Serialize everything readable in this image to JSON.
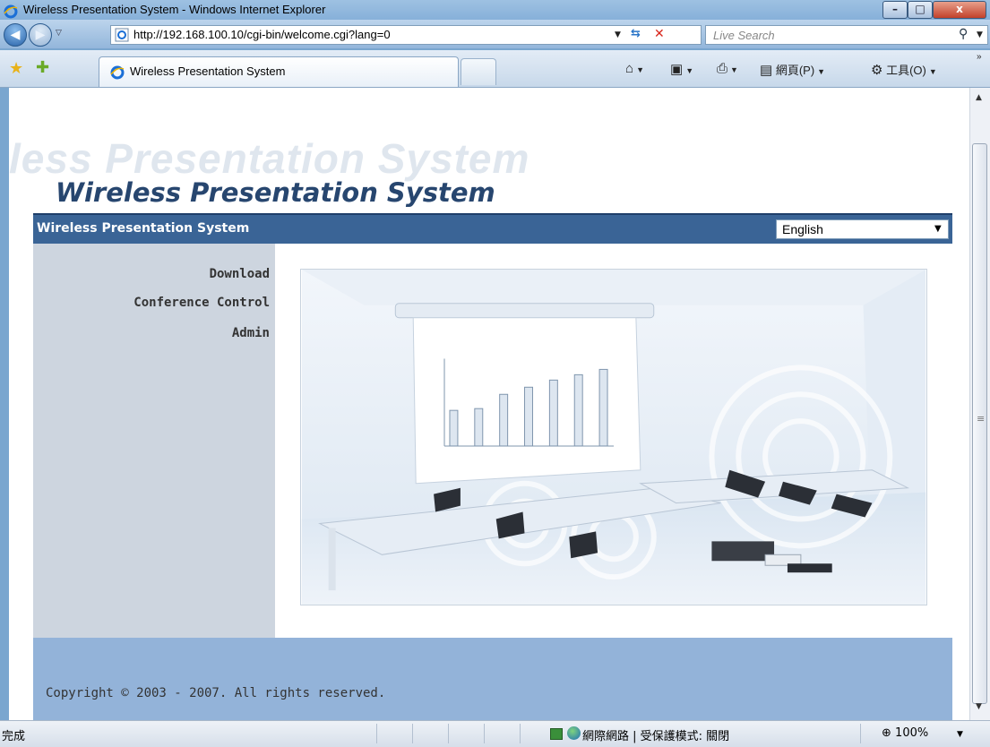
{
  "window": {
    "title": "Wireless Presentation System - Windows Internet Explorer",
    "buttons": {
      "minimize": "–",
      "maximize": "□",
      "close": "x"
    }
  },
  "address_bar": {
    "url": "http://192.168.100.10/cgi-bin/welcome.cgi?lang=0",
    "search_placeholder": "Live Search"
  },
  "tabs": [
    {
      "label": "Wireless Presentation System"
    }
  ],
  "command_bar": {
    "page_menu": "網頁(P)",
    "tools_menu": "工具(O)"
  },
  "page": {
    "logo_text": "Wireless Presentation System",
    "logo_ghost": "less Presentation System",
    "header_title": "Wireless Presentation System",
    "language": {
      "selected": "English"
    },
    "sidebar": {
      "items": [
        {
          "label": "Download"
        },
        {
          "label": "Conference Control"
        },
        {
          "label": "Admin"
        }
      ]
    },
    "footer": {
      "copyright": "Copyright © 2003 - 2007. All rights reserved."
    }
  },
  "status_bar": {
    "status": "完成",
    "zone": "網際網路 | 受保護模式: 關閉",
    "zoom": "100%"
  },
  "colors": {
    "header_bar": "#3a6496",
    "sidebar": "#cdd5df",
    "footer": "#93b3d9",
    "logo": "#27466f"
  }
}
